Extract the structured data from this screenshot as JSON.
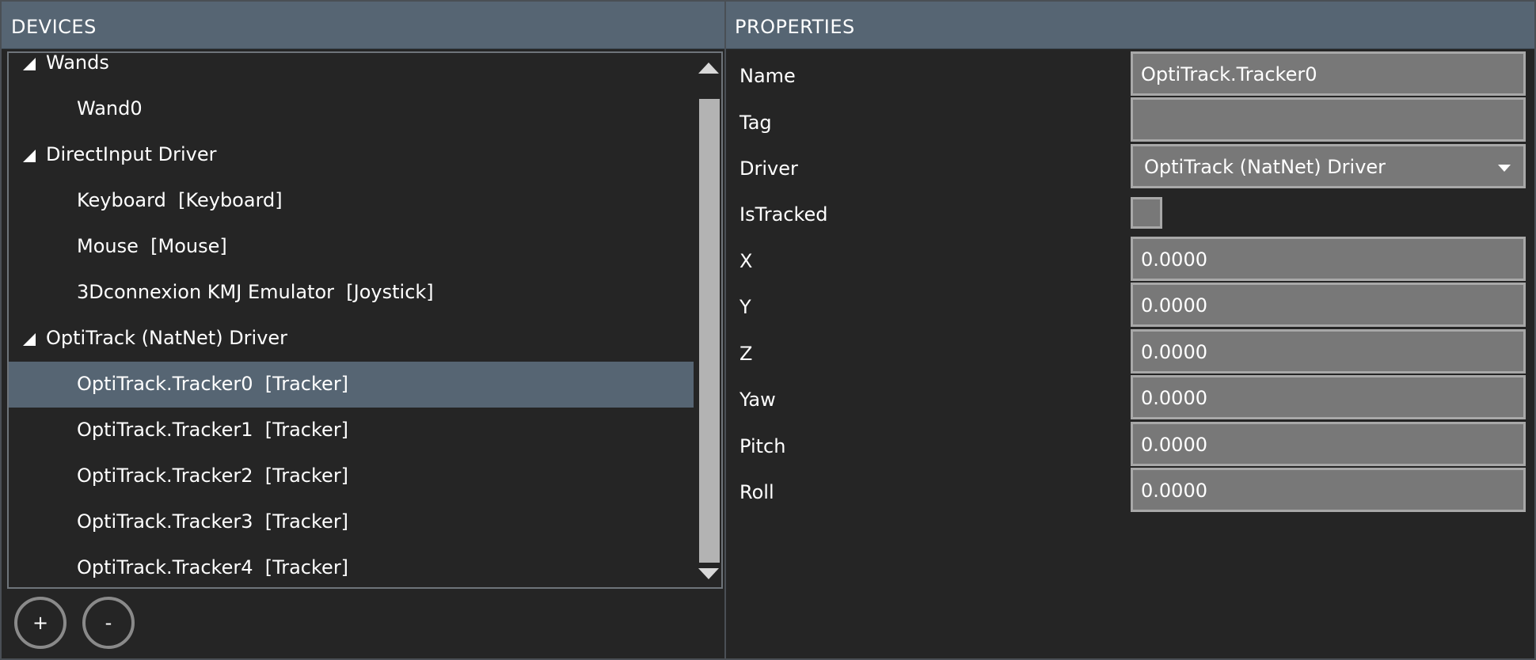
{
  "devices": {
    "title": "DEVICES",
    "tree": [
      {
        "type": "group",
        "label": "Wands"
      },
      {
        "type": "child",
        "label": "Wand0"
      },
      {
        "type": "group",
        "label": "DirectInput Driver"
      },
      {
        "type": "child",
        "label": "Keyboard  [Keyboard]"
      },
      {
        "type": "child",
        "label": "Mouse  [Mouse]"
      },
      {
        "type": "child",
        "label": "3Dconnexion KMJ Emulator  [Joystick]"
      },
      {
        "type": "group",
        "label": "OptiTrack (NatNet) Driver"
      },
      {
        "type": "child",
        "label": "OptiTrack.Tracker0  [Tracker]",
        "selected": true
      },
      {
        "type": "child",
        "label": "OptiTrack.Tracker1  [Tracker]"
      },
      {
        "type": "child",
        "label": "OptiTrack.Tracker2  [Tracker]"
      },
      {
        "type": "child",
        "label": "OptiTrack.Tracker3  [Tracker]"
      },
      {
        "type": "child",
        "label": "OptiTrack.Tracker4  [Tracker]"
      }
    ],
    "add_label": "+",
    "remove_label": "-"
  },
  "properties": {
    "title": "PROPERTIES",
    "name": {
      "label": "Name",
      "value": "OptiTrack.Tracker0"
    },
    "tag": {
      "label": "Tag",
      "value": ""
    },
    "driver": {
      "label": "Driver",
      "value": "OptiTrack (NatNet) Driver"
    },
    "istracked": {
      "label": "IsTracked",
      "checked": false
    },
    "x": {
      "label": "X",
      "value": "0.0000"
    },
    "y": {
      "label": "Y",
      "value": "0.0000"
    },
    "z": {
      "label": "Z",
      "value": "0.0000"
    },
    "yaw": {
      "label": "Yaw",
      "value": "0.0000"
    },
    "pitch": {
      "label": "Pitch",
      "value": "0.0000"
    },
    "roll": {
      "label": "Roll",
      "value": "0.0000"
    }
  },
  "colors": {
    "header": "#566573",
    "background": "#252525",
    "selected_row": "#566573",
    "field_fill": "#787878"
  }
}
